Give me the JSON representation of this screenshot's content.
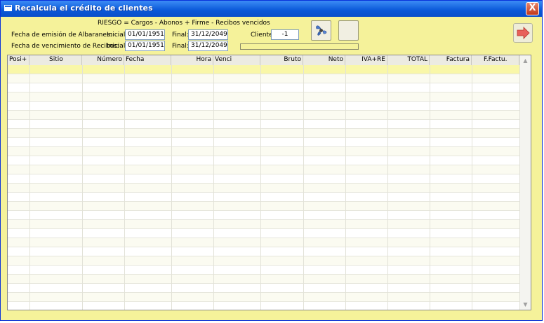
{
  "window": {
    "title": "Recalcula el crédito de clientes",
    "close_label": "X"
  },
  "formula": "RIESGO = Cargos - Abonos + Firme - Recibos vencidos",
  "albaranes": {
    "label": "Fecha de emisión de Albaranes:",
    "inicial_label": "Inicial:",
    "inicial_value": "01/01/1951",
    "final_label": "Final:",
    "final_value": "31/12/2049"
  },
  "recibos": {
    "label": "Fecha de vencimiento de Recibos:",
    "inicial_label": "Inicial:",
    "inicial_value": "01/01/1951",
    "final_label": "Final:",
    "final_value": "31/12/2049"
  },
  "cliente": {
    "label": "Cliente:",
    "value": "-1"
  },
  "progress": {
    "fraction": 0
  },
  "icons": {
    "run": "fan-icon",
    "blank": "blank-button",
    "exit": "exit-arrow-icon"
  },
  "table": {
    "columns": [
      "Posi+",
      "Sitio",
      "Número",
      "Fecha",
      "Hora",
      "Venci",
      "Bruto",
      "Neto",
      "IVA+RE",
      "TOTAL",
      "Factura",
      "F.Factu."
    ]
  },
  "scroll": {
    "up": "▲",
    "down": "▼"
  }
}
